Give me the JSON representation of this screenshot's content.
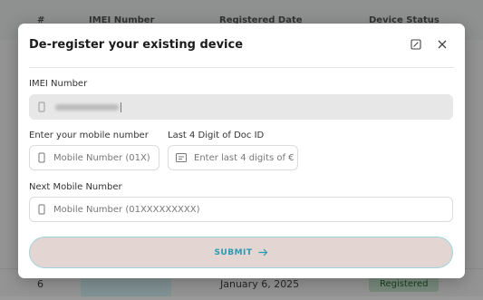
{
  "background": {
    "headers": [
      "#",
      "IMEI Number",
      "Registered Date",
      "Device Status"
    ],
    "visible_row": {
      "index": "6",
      "date": "January 6, 2025",
      "status": "Registered"
    }
  },
  "modal": {
    "title": "De-register your existing device",
    "imei": {
      "label": "IMEI Number"
    },
    "mobile": {
      "label": "Enter your mobile number",
      "placeholder": "Mobile Number (01X)"
    },
    "docid": {
      "label": "Last 4 Digit of Doc ID",
      "placeholder": "Enter last 4 digits of €"
    },
    "next_mobile": {
      "label": "Next Mobile Number",
      "placeholder": "Mobile Number (01XXXXXXXXX)"
    },
    "submit_label": "SUBMIT"
  },
  "icons": {
    "maximize": "maximize-icon",
    "close": "close-icon",
    "phone": "phone-icon",
    "id_card": "id-card-icon",
    "arrow": "arrow-right-icon"
  },
  "colors": {
    "accent": "#2a9bb2",
    "submit_bg": "#e3d5d2",
    "submit_border": "#9fd4dc",
    "badge_bg": "#c9e7cf"
  }
}
